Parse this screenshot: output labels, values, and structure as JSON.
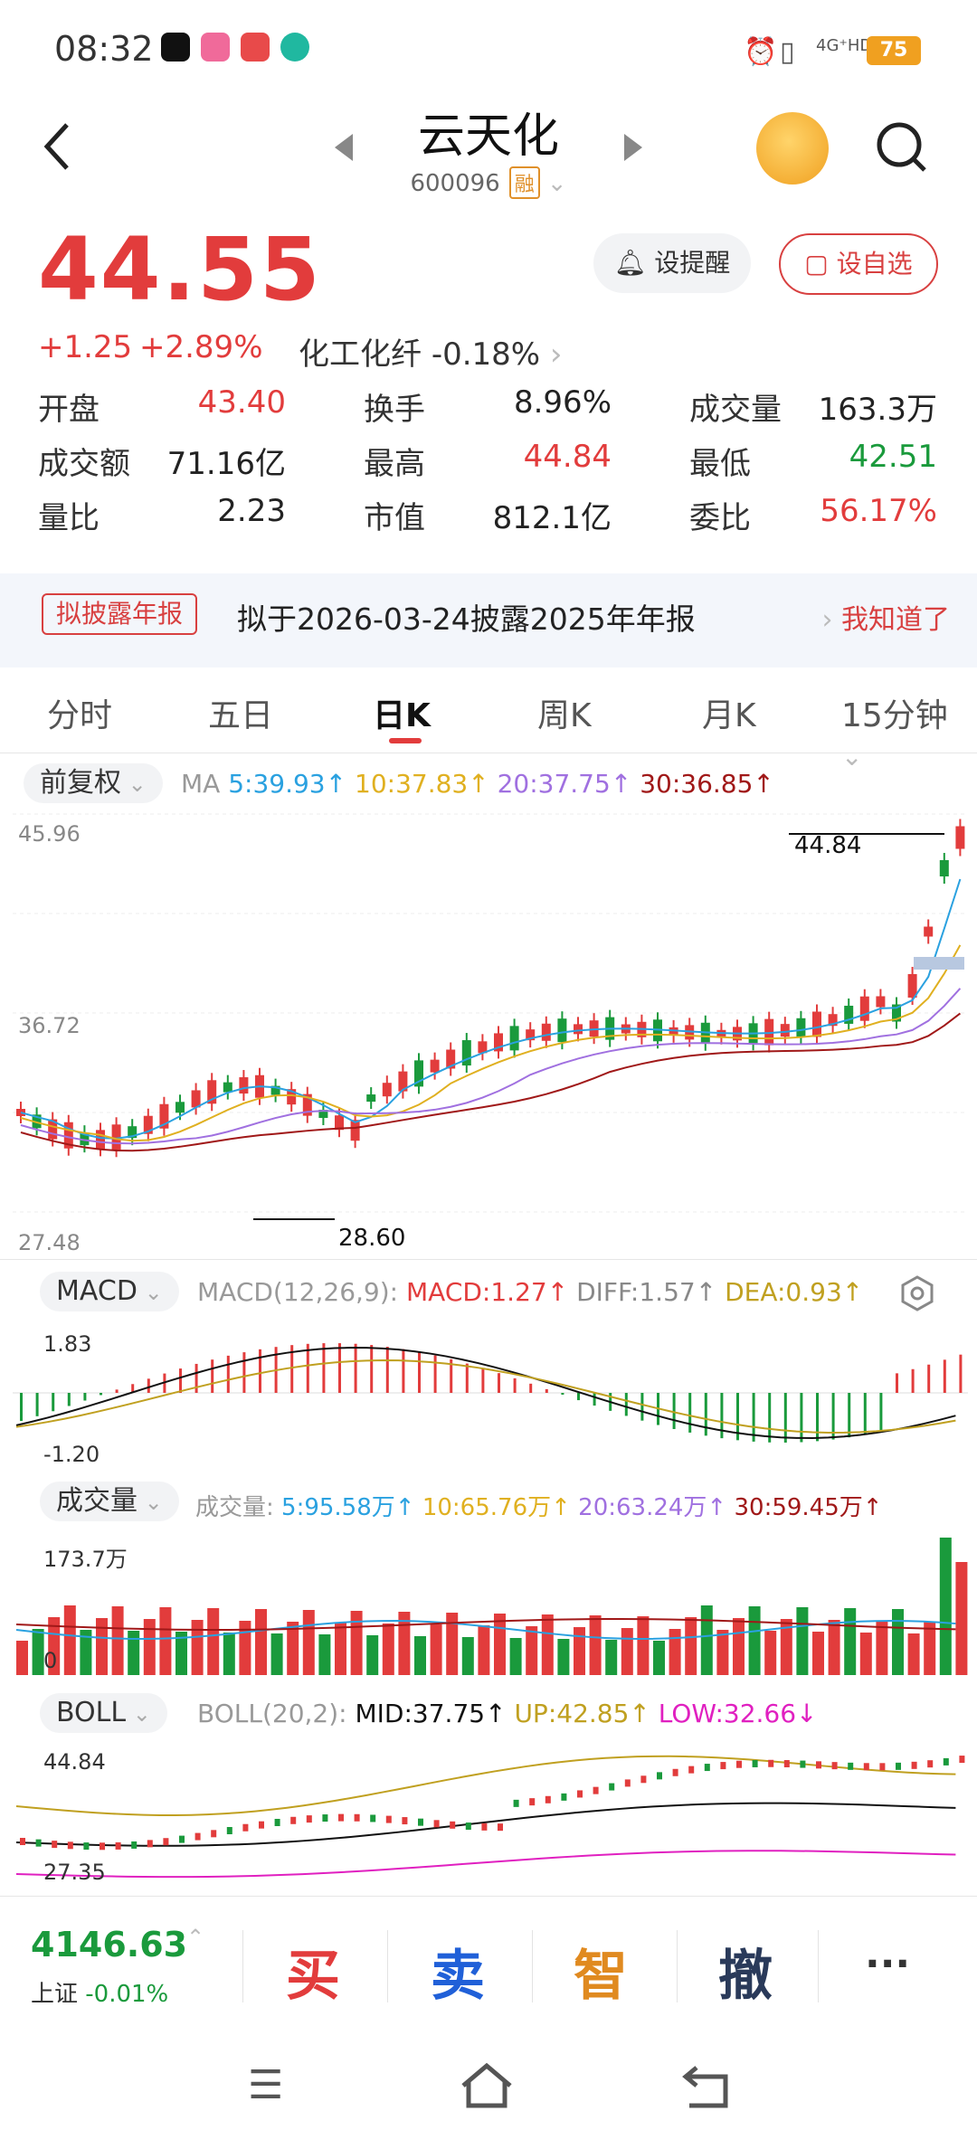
{
  "status": {
    "time": "08:32",
    "signal": "4G⁺HD",
    "battery": "75"
  },
  "header": {
    "title": "云天化",
    "code": "600096",
    "rong": "融"
  },
  "quote": {
    "price": "44.55",
    "change": "+1.25",
    "change_pct": "+2.89%",
    "sector": "化工化纤",
    "sector_pct": "-0.18%"
  },
  "stats": {
    "open_label": "开盘",
    "open": "43.40",
    "turnover_label": "换手",
    "turnover": "8.96%",
    "volume_label": "成交量",
    "volume": "163.3万",
    "amount_label": "成交额",
    "amount": "71.16亿",
    "high_label": "最高",
    "high": "44.84",
    "low_label": "最低",
    "low": "42.51",
    "ratio_label": "量比",
    "ratio": "2.23",
    "mcap_label": "市值",
    "mcap": "812.1亿",
    "entrust_label": "委比",
    "entrust": "56.17%"
  },
  "buttons": {
    "remind": "设提醒",
    "fav": "设自选"
  },
  "notice": {
    "tag": "拟披露年报",
    "text": "拟于2026-03-24披露2025年年报",
    "link": "我知道了"
  },
  "tabs": [
    "分时",
    "五日",
    "日K",
    "周K",
    "月K",
    "15分钟"
  ],
  "kline": {
    "adjust": "前复权",
    "ma_title": "MA",
    "ma5": "5:39.93↑",
    "ma10": "10:37.83↑",
    "ma20": "20:37.75↑",
    "ma30": "30:36.85↑",
    "axis_top": "45.96",
    "axis_mid": "36.72",
    "axis_bot": "27.48",
    "max_label": "44.84",
    "min_label": "28.60"
  },
  "macd": {
    "pill": "MACD",
    "params": "MACD(12,26,9):",
    "macd": "MACD:1.27↑",
    "diff": "DIFF:1.57↑",
    "dea": "DEA:0.93↑",
    "axis_top": "1.83",
    "axis_bot": "-1.20"
  },
  "vol": {
    "pill": "成交量",
    "title": "成交量:",
    "v5": "5:95.58万↑",
    "v10": "10:65.76万↑",
    "v20": "20:63.24万↑",
    "v30": "30:59.45万↑",
    "axis_top": "173.7万",
    "axis_bot": "0"
  },
  "boll": {
    "pill": "BOLL",
    "params": "BOLL(20,2):",
    "mid": "MID:37.75↑",
    "up": "UP:42.85↑",
    "low": "LOW:32.66↓",
    "axis_top": "44.84",
    "axis_bot": "27.35"
  },
  "footer": {
    "index_val": "4146.63",
    "index_name": "上证",
    "index_pct": "-0.01%",
    "buy": "买",
    "sell": "卖",
    "smart": "智",
    "cancel": "撤",
    "more": "···"
  },
  "colors": {
    "up": "#e23c3c",
    "down": "#1a9a3c",
    "ma5": "#2aa1e0",
    "ma10": "#e0b020",
    "ma20": "#a070e0",
    "ma30": "#a01818"
  }
}
